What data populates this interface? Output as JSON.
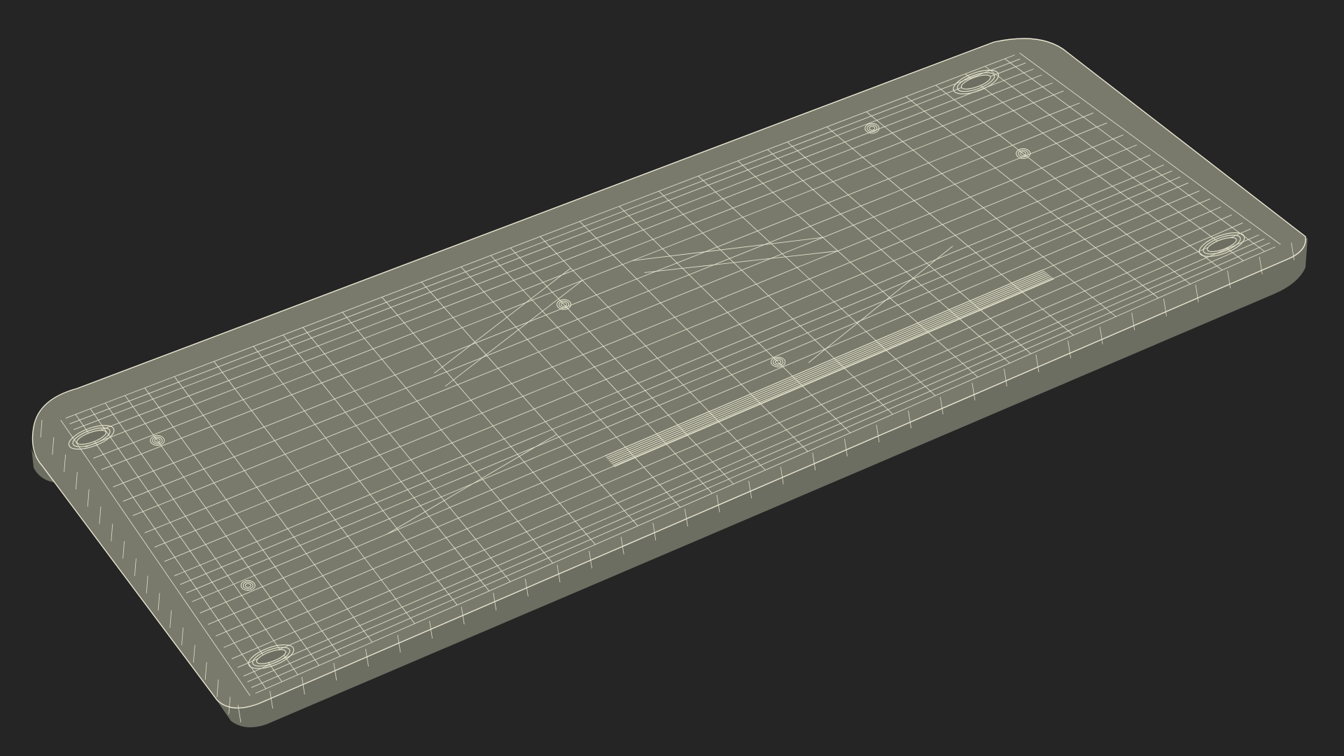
{
  "scene": {
    "background_color": "#252525",
    "surface_color": "#797a6c",
    "side_color": "#6d6e62",
    "wire_color": "#ece9d3",
    "subject": "wireframe-panel"
  }
}
